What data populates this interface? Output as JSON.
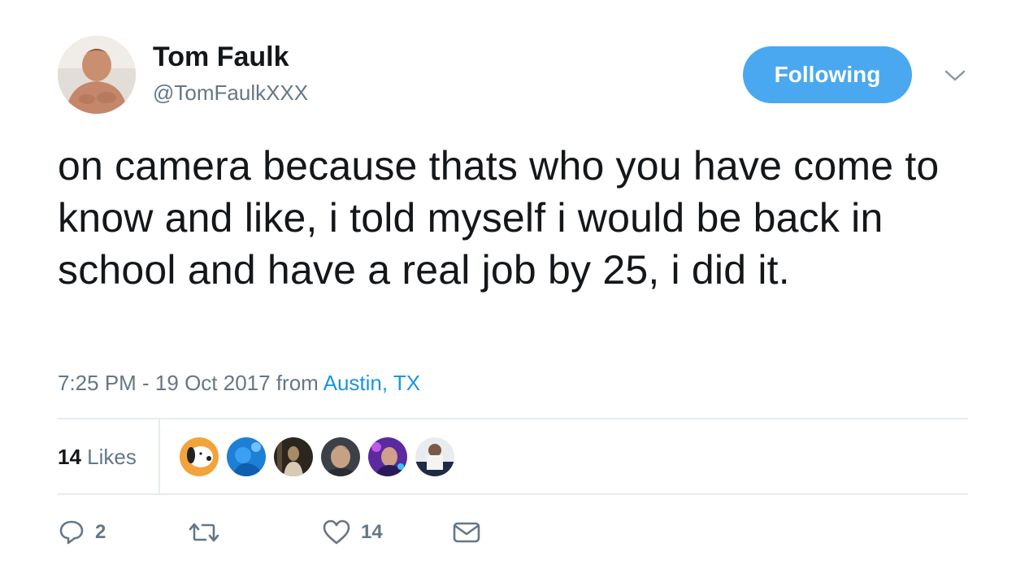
{
  "author": {
    "name": "Tom Faulk",
    "handle": "@TomFaulkXXX"
  },
  "follow_button": {
    "label": "Following",
    "color": "#4aa8f0"
  },
  "tweet": {
    "text": "on camera because thats who you have come to know and like, i told myself i would be back in school and have a real job by 25, i did it."
  },
  "meta": {
    "time": "7:25 PM - 19 Oct 2017",
    "from_label": "from",
    "location": "Austin, TX"
  },
  "likes": {
    "count": "14",
    "label": "Likes",
    "avatars": [
      "snoopy-avatar",
      "blue-avatar",
      "dark-portrait-avatar",
      "man-portrait-avatar",
      "purple-avatar",
      "group-avatar"
    ]
  },
  "actions": {
    "reply_count": "2",
    "retweet_count": "",
    "like_count": "14"
  },
  "colors": {
    "text": "#14171a",
    "secondary": "#657786",
    "link": "#1b95e0",
    "divider": "#e6ecf0"
  }
}
